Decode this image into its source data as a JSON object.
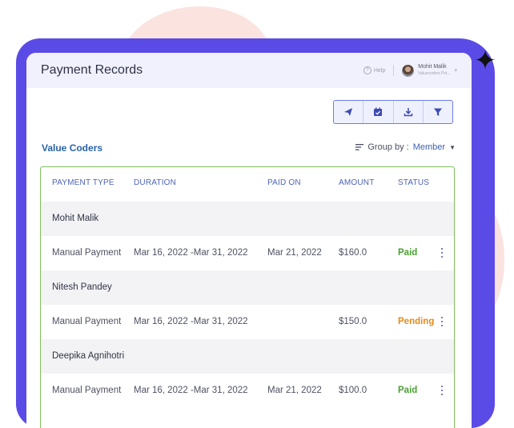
{
  "header": {
    "title": "Payment Records",
    "help_label": "Help",
    "user_name": "Mohit Malik",
    "user_org": "Valuecoders Pvt..."
  },
  "toolbar": {
    "buttons": [
      {
        "icon": "send-icon"
      },
      {
        "icon": "calendar-check-icon"
      },
      {
        "icon": "download-icon"
      },
      {
        "icon": "filter-icon"
      }
    ]
  },
  "org": {
    "name": "Value Coders"
  },
  "group_by": {
    "label": "Group by :",
    "value": "Member"
  },
  "table": {
    "columns": [
      "PAYMENT TYPE",
      "DURATION",
      "PAID ON",
      "AMOUNT",
      "STATUS"
    ],
    "groups": [
      {
        "member": "Mohit Malik",
        "rows": [
          {
            "type": "Manual Payment",
            "duration": "Mar 16, 2022 -Mar 31, 2022",
            "paid_on": "Mar 21, 2022",
            "amount": "$160.0",
            "status": "Paid"
          }
        ]
      },
      {
        "member": "Nitesh Pandey",
        "rows": [
          {
            "type": "Manual Payment",
            "duration": "Mar 16, 2022 -Mar 31, 2022",
            "paid_on": "",
            "amount": "$150.0",
            "status": "Pending"
          }
        ]
      },
      {
        "member": "Deepika Agnihotri",
        "rows": [
          {
            "type": "Manual Payment",
            "duration": "Mar 16, 2022 -Mar 31, 2022",
            "paid_on": "Mar 21, 2022",
            "amount": "$100.0",
            "status": "Paid"
          }
        ]
      }
    ]
  },
  "colors": {
    "accent": "#5b4be6",
    "paid": "#4aa133",
    "pending": "#e58a1b",
    "table_border": "#7fbf5b"
  }
}
